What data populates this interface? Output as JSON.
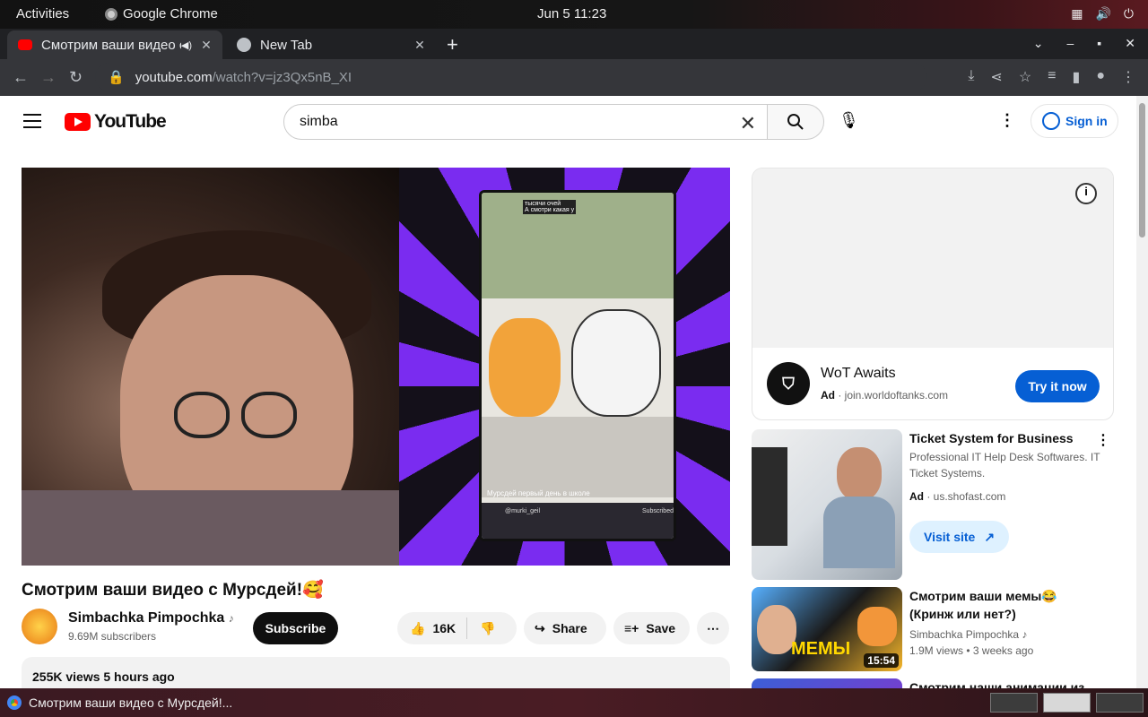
{
  "system": {
    "activities": "Activities",
    "app_name": "Google Chrome",
    "clock": "Jun 5  11:23"
  },
  "tabs": [
    {
      "title": "Смотрим ваши видео с Мурсдей!🥰",
      "active": true
    },
    {
      "title": "New Tab",
      "active": false
    }
  ],
  "address": {
    "domain": "youtube.com",
    "path": "/watch?v=jz3Qx5nB_XI"
  },
  "youtube": {
    "logo_text": "YouTube",
    "search_query": "simba",
    "sign_in": "Sign in"
  },
  "video": {
    "overlay_top_caption": "тысячи очей\nА смотри какая у",
    "overlay_bottom_caption": "Мурсдей первый день в школе",
    "overlay_channel": "@murki_geil",
    "overlay_subscribed": "Subscribed",
    "title": "Смотрим ваши видео с Мурсдей!🥰",
    "channel": "Simbachka Pimpochka",
    "subscribers": "9.69M subscribers",
    "subscribe": "Subscribe",
    "likes": "16K",
    "share": "Share",
    "save": "Save",
    "views_time": "255K views  5 hours ago"
  },
  "ad": {
    "name": "WoT Awaits",
    "badge": "Ad",
    "domain": "join.worldoftanks.com",
    "cta": "Try it now"
  },
  "recommendations": [
    {
      "title": "Ticket System for Business",
      "desc": "Professional IT Help Desk Softwares. IT Ticket Systems.",
      "badge": "Ad",
      "domain": "us.shofast.com",
      "cta": "Visit site"
    },
    {
      "title": "Смотрим ваши мемы😂 (Кринж или нет?)",
      "channel": "Simbachka Pimpochka",
      "views": "1.9M views",
      "age": "3 weeks ago",
      "duration": "15:54",
      "thumb_text": "МЕМЫ"
    },
    {
      "title": "Смотрим наши анимации из"
    }
  ],
  "taskbar": {
    "window_title": "Смотрим ваши видео с Мурсдей!..."
  }
}
